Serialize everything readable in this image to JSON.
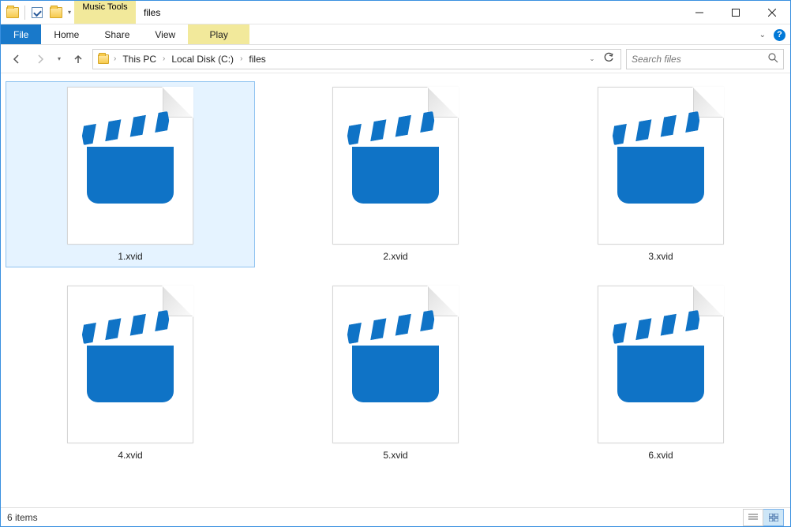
{
  "titlebar": {
    "contextual_label": "Music Tools",
    "window_title": "files"
  },
  "ribbon": {
    "file": "File",
    "tabs": [
      "Home",
      "Share",
      "View"
    ],
    "play": "Play"
  },
  "breadcrumb": {
    "parts": [
      "This PC",
      "Local Disk (C:)",
      "files"
    ]
  },
  "search": {
    "placeholder": "Search files"
  },
  "files": [
    {
      "name": "1.xvid",
      "selected": true
    },
    {
      "name": "2.xvid",
      "selected": false
    },
    {
      "name": "3.xvid",
      "selected": false
    },
    {
      "name": "4.xvid",
      "selected": false
    },
    {
      "name": "5.xvid",
      "selected": false
    },
    {
      "name": "6.xvid",
      "selected": false
    }
  ],
  "status": {
    "count_label": "6 items"
  }
}
